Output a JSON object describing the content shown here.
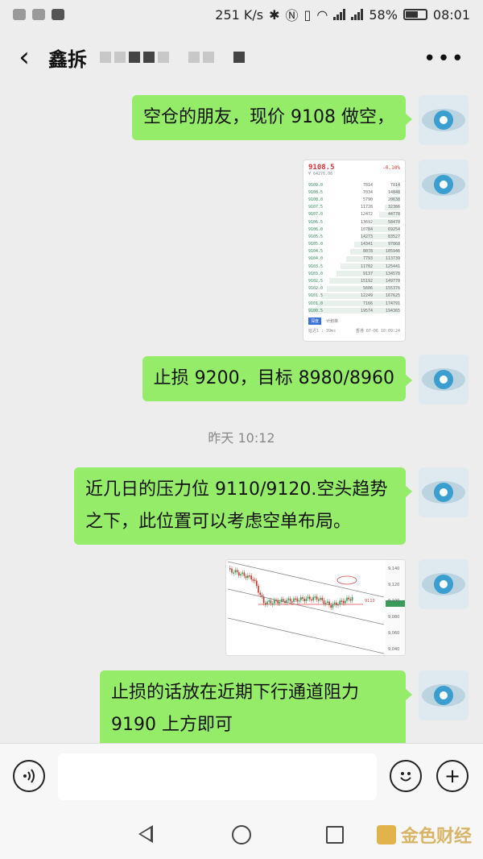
{
  "status_bar": {
    "speed": "251 K/s",
    "battery": "58%",
    "time": "08:01",
    "net1": "4G",
    "net2": "2G"
  },
  "header": {
    "title": "鑫拆",
    "back_icon": "chevron-left-icon",
    "more_icon": "more-icon"
  },
  "messages": {
    "m1": "空仓的朋友，现价 9108 做空，",
    "m3": "止损 9200，目标 8980/8960",
    "m4": "近几日的压力位 9110/9120.空头趋势之下，此位置可以考虑空单布局。",
    "m6": "止损的话放在近期下行通道阻力 9190 上方即可"
  },
  "timestamp": "昨天 10:12",
  "orderbook": {
    "price": "9108.5",
    "change": "-0.10%",
    "sub": "¥ 64276.06",
    "rows": [
      [
        "9109.0",
        "7814",
        "7814"
      ],
      [
        "9108.5",
        "7034",
        "14848"
      ],
      [
        "9108.0",
        "5790",
        "20638"
      ],
      [
        "9107.5",
        "11728",
        "32366"
      ],
      [
        "9107.0",
        "12472",
        "44778"
      ],
      [
        "9106.5",
        "13692",
        "58470"
      ],
      [
        "9106.0",
        "10784",
        "69254"
      ],
      [
        "9105.5",
        "14273",
        "83527"
      ],
      [
        "9105.0",
        "14341",
        "97868"
      ],
      [
        "9104.5",
        "8078",
        "105946"
      ],
      [
        "9104.0",
        "7793",
        "113739"
      ],
      [
        "9103.5",
        "11702",
        "125441"
      ],
      [
        "9103.0",
        "9137",
        "134578"
      ],
      [
        "9102.5",
        "15192",
        "149770"
      ],
      [
        "9102.0",
        "5606",
        "155376"
      ],
      [
        "9101.5",
        "12249",
        "167625"
      ],
      [
        "9101.0",
        "7166",
        "174791"
      ],
      [
        "9100.5",
        "19574",
        "194365"
      ]
    ],
    "tab_active": "深度",
    "tab_inactive": "计划单",
    "status_left": "延迟1 : 39ms",
    "status_right": "香港 07-06 10:09:24"
  },
  "candle_chart": {
    "levels": [
      "9,140",
      "9,120",
      "9,100",
      "9,080",
      "9,060",
      "9,040"
    ],
    "marker": "9110"
  },
  "footer": {
    "watermark": "金色财经"
  },
  "colors": {
    "bubble": "#95ec69",
    "background": "#ededed"
  }
}
